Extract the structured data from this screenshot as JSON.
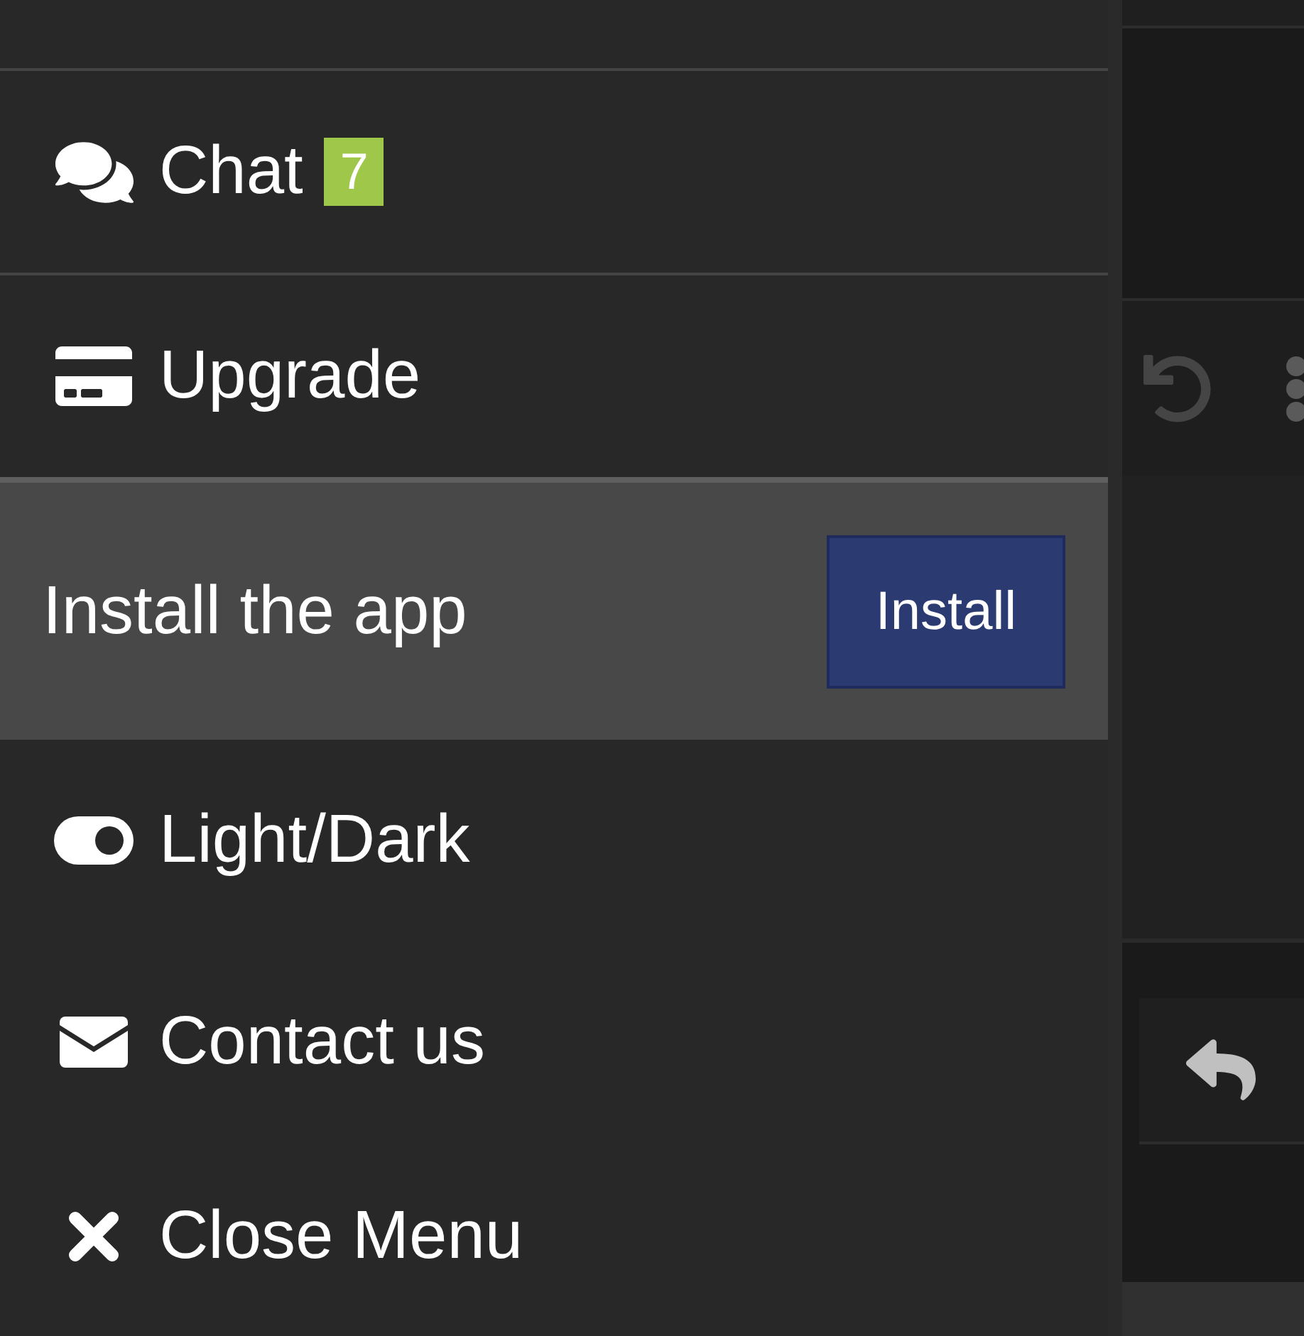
{
  "menu": {
    "items": [
      {
        "kind": "link",
        "label": "Chat",
        "badge": "7"
      },
      {
        "kind": "link",
        "label": "Upgrade"
      },
      {
        "kind": "install",
        "label": "Install the app",
        "button": "Install"
      },
      {
        "kind": "link",
        "label": "Light/Dark"
      },
      {
        "kind": "link",
        "label": "Contact us"
      },
      {
        "kind": "link",
        "label": "Close Menu"
      }
    ]
  }
}
